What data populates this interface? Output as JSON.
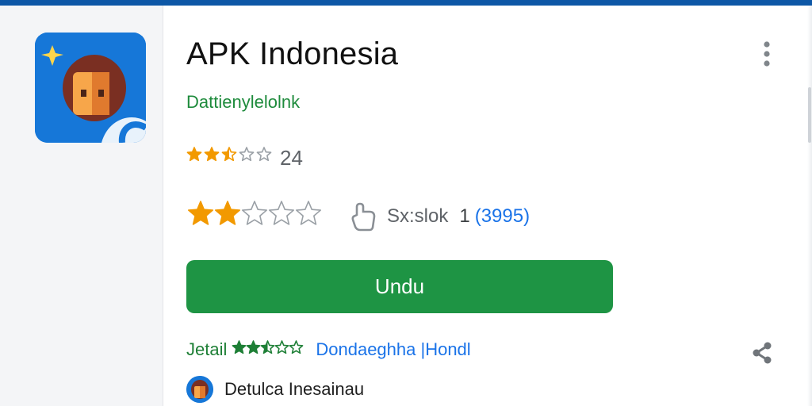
{
  "app": {
    "title": "APK Indonesia",
    "developer": "Dattienylelolnk"
  },
  "rating_primary": {
    "stars": 2.5,
    "value_text": "24"
  },
  "rating_secondary": {
    "stars": 2,
    "install_label": "Sx:slok",
    "install_count": "1",
    "install_detail": "(3995)"
  },
  "download_button": {
    "label": "Undu"
  },
  "detail_row": {
    "label": "Jetail",
    "stars": 2.5,
    "link": "Dondaeghha |Hondl"
  },
  "footer": {
    "text": "Detulca Inesainau"
  },
  "colors": {
    "top_bar": "#0d57a6",
    "star": "#f29900",
    "green": "#1e9444",
    "link": "#1a73e8"
  },
  "icons": {
    "app_icon": "app-logo",
    "more": "more-vertical-icon",
    "share": "share-icon",
    "hand": "hand-icon",
    "avatar": "avatar-icon"
  }
}
